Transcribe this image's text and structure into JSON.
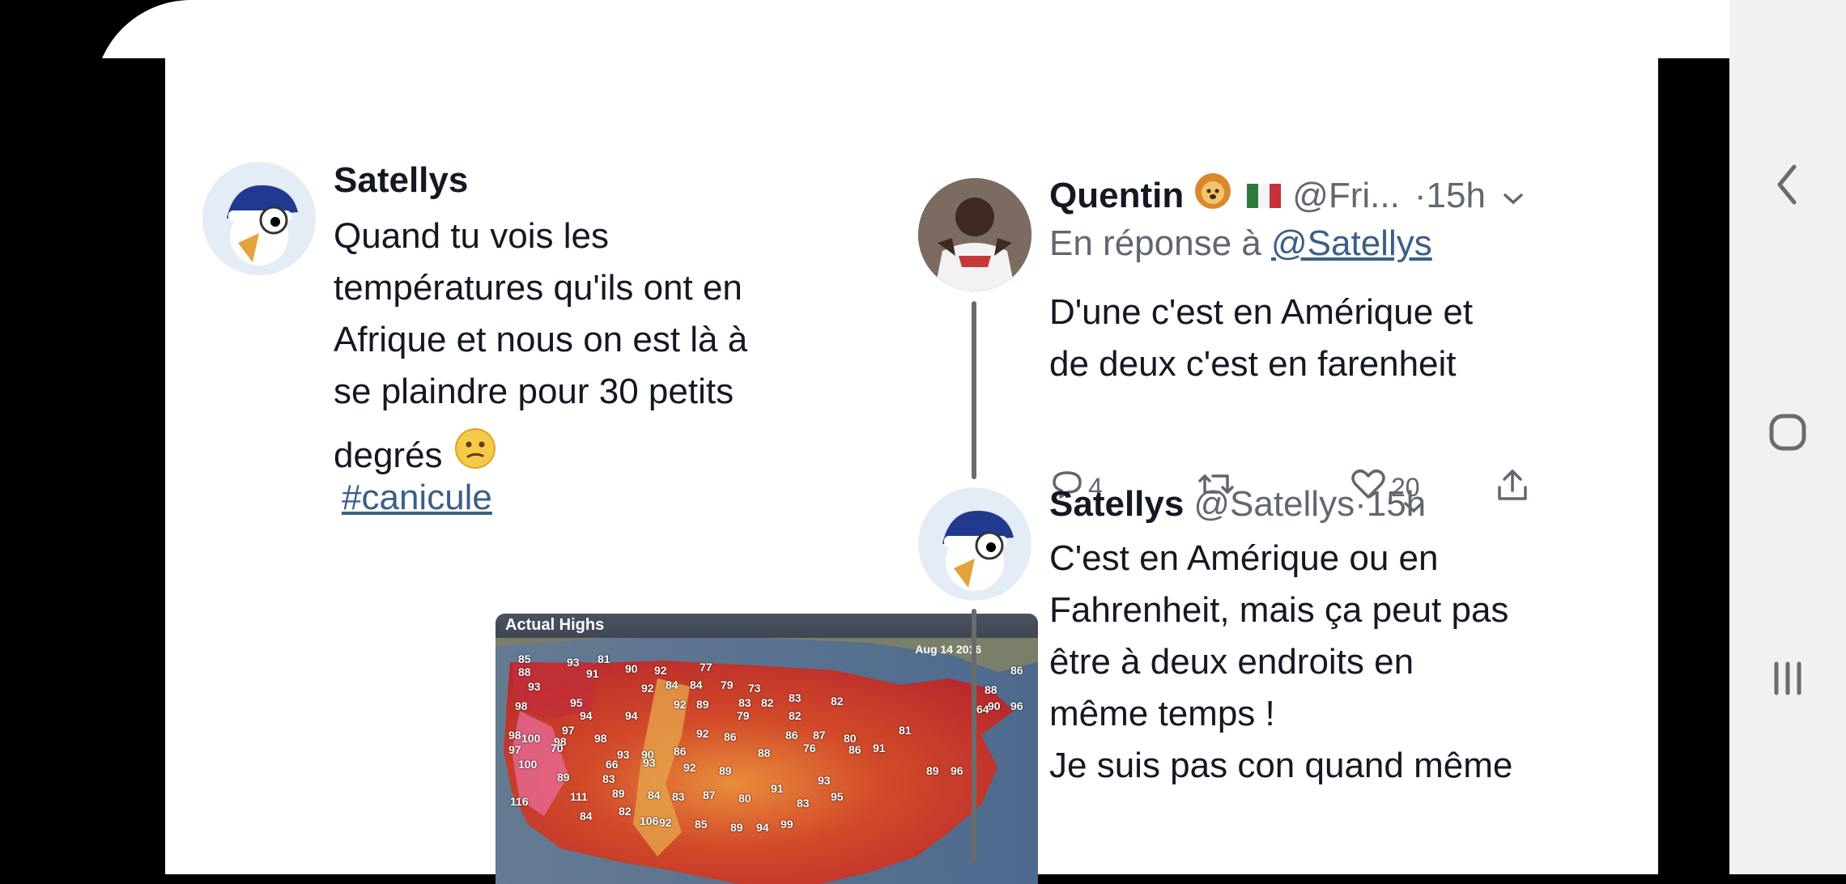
{
  "left_tweet": {
    "name": "Satellys",
    "body": [
      "Quand tu vois les",
      "températures qu'ils ont en",
      "Afrique et nous on est là à",
      "se plaindre pour 30 petits",
      "degrés"
    ],
    "hashtag": "#canicule",
    "emoji_icon": "confused-face-icon",
    "map": {
      "title": "Actual Highs",
      "date": "Aug 14 2016",
      "labels": [
        "85",
        "93",
        "81",
        "88",
        "91",
        "90",
        "92",
        "77",
        "93",
        "92",
        "84",
        "84",
        "79",
        "73",
        "88",
        "98",
        "95",
        "92",
        "89",
        "83",
        "82",
        "83",
        "82",
        "90",
        "96",
        "94",
        "94",
        "79",
        "82",
        "98",
        "100",
        "97",
        "98",
        "98",
        "92",
        "86",
        "86",
        "87",
        "80",
        "81",
        "97",
        "70",
        "93",
        "90",
        "86",
        "88",
        "76",
        "86",
        "91",
        "100",
        "66",
        "93",
        "92",
        "89",
        "83",
        "89",
        "96",
        "89",
        "111",
        "89",
        "84",
        "83",
        "87",
        "80",
        "91",
        "93",
        "116",
        "84",
        "82",
        "106",
        "92",
        "85",
        "89",
        "94",
        "99",
        "83",
        "95",
        "64",
        "86"
      ]
    }
  },
  "reply_tweet": {
    "name": "Quentin",
    "handle": "@Fri...",
    "time": "·15h",
    "in_reply_prefix": "En réponse à",
    "in_reply_handle": "@Satellys",
    "body": [
      "D'une c'est en Amérique et",
      "de deux c'est en farenheit"
    ],
    "counts": {
      "replies": "4",
      "likes": "20"
    },
    "icons": [
      "reply-icon",
      "retweet-icon",
      "like-icon",
      "share-icon"
    ]
  },
  "second_reply": {
    "name": "Satellys",
    "handle": "@Satellys",
    "time": "·15h",
    "body": [
      "C'est en Amérique ou en",
      "Fahrenheit, mais ça peut pas",
      "être à deux endroits en",
      "même temps !",
      "Je suis pas con quand même"
    ]
  },
  "navbar": {
    "icons": [
      "back-icon",
      "home-icon",
      "recents-icon"
    ]
  },
  "colors": {
    "map_hot": "#c9351f",
    "map_warm": "#e0813a",
    "link": "#3a5f88",
    "text": "#141823"
  }
}
